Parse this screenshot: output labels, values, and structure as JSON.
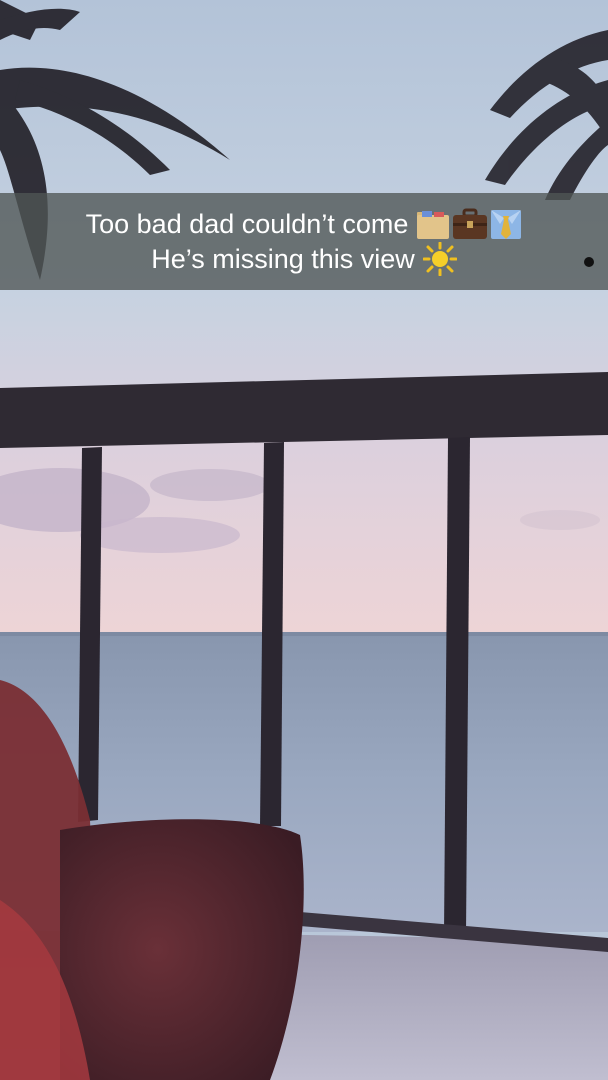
{
  "snap": {
    "caption": {
      "line1": "Too bad dad couldn’t come",
      "line2": "He’s missing this view",
      "line1_emojis": [
        "file-folder-icon",
        "briefcase-icon",
        "necktie-shirt-icon"
      ],
      "line2_emojis": [
        "sun-icon"
      ]
    }
  },
  "colors": {
    "caption_bar": "#50565499",
    "sky_top": "#b6c6da",
    "sky_sunset": "#e8cfd6",
    "ocean": "#8e9db6",
    "railing": "#2e2a33"
  }
}
